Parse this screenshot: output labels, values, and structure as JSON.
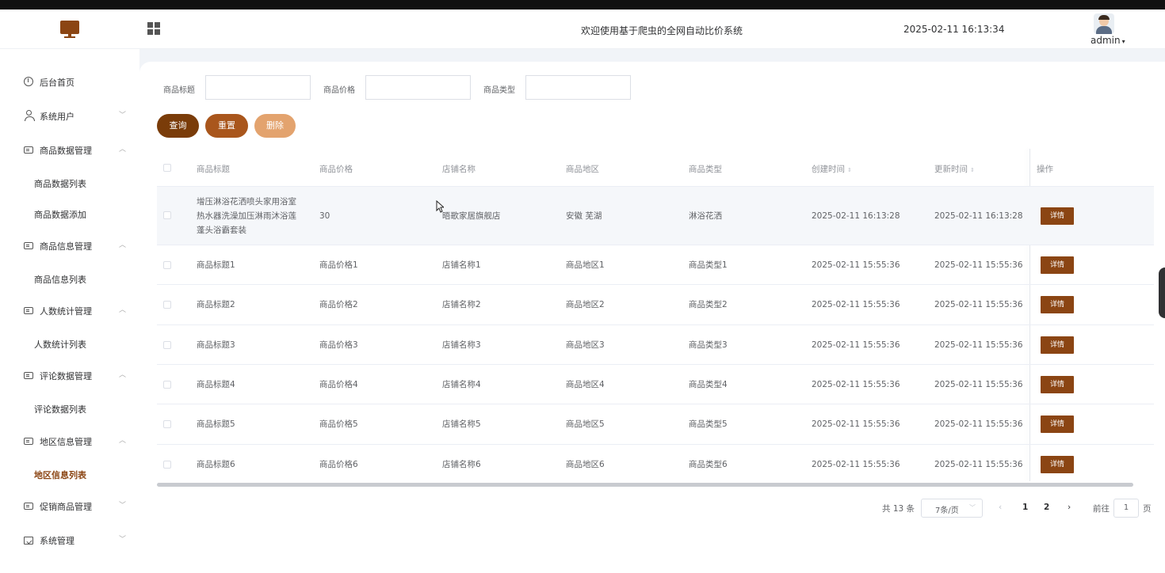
{
  "header": {
    "title": "欢迎使用基于爬虫的全网自动比价系统",
    "datetime": "2025-02-11 16:13:34",
    "user": "admin"
  },
  "sidebar": {
    "items": [
      {
        "label": "后台首页",
        "icon": "clock-icon",
        "arrow": ""
      },
      {
        "label": "系统用户",
        "icon": "user-icon",
        "arrow": "﹀"
      },
      {
        "label": "商品数据管理",
        "icon": "card-icon",
        "arrow": "︿"
      },
      {
        "label": "商品数据列表"
      },
      {
        "label": "商品数据添加"
      },
      {
        "label": "商品信息管理",
        "icon": "card-icon",
        "arrow": "︿"
      },
      {
        "label": "商品信息列表"
      },
      {
        "label": "人数统计管理",
        "icon": "card-icon",
        "arrow": "︿"
      },
      {
        "label": "人数统计列表"
      },
      {
        "label": "评论数据管理",
        "icon": "card-icon",
        "arrow": "︿"
      },
      {
        "label": "评论数据列表"
      },
      {
        "label": "地区信息管理",
        "icon": "card-icon",
        "arrow": "︿"
      },
      {
        "label": "地区信息列表"
      },
      {
        "label": "促销商品管理",
        "icon": "card-icon",
        "arrow": "﹀"
      },
      {
        "label": "系统管理",
        "icon": "folder-icon",
        "arrow": "﹀"
      }
    ]
  },
  "filters": {
    "title_label": "商品标题",
    "price_label": "商品价格",
    "type_label": "商品类型"
  },
  "buttons": {
    "query": "查询",
    "reset": "重置",
    "delete": "删除"
  },
  "table": {
    "headers": [
      "商品标题",
      "商品价格",
      "店铺名称",
      "商品地区",
      "商品类型",
      "创建时间",
      "更新时间",
      "操作"
    ],
    "detail_label": "详情",
    "rows": [
      {
        "title": "增压淋浴花洒喷头家用浴室热水器洗澡加压淋雨沐浴莲蓬头浴霸套装",
        "price": "30",
        "shop": "晤歌家居旗舰店",
        "region": "安徽 芜湖",
        "type": "淋浴花洒",
        "created": "2025-02-11 16:13:28",
        "updated": "2025-02-11 16:13:28"
      },
      {
        "title": "商品标题1",
        "price": "商品价格1",
        "shop": "店铺名称1",
        "region": "商品地区1",
        "type": "商品类型1",
        "created": "2025-02-11 15:55:36",
        "updated": "2025-02-11 15:55:36"
      },
      {
        "title": "商品标题2",
        "price": "商品价格2",
        "shop": "店铺名称2",
        "region": "商品地区2",
        "type": "商品类型2",
        "created": "2025-02-11 15:55:36",
        "updated": "2025-02-11 15:55:36"
      },
      {
        "title": "商品标题3",
        "price": "商品价格3",
        "shop": "店铺名称3",
        "region": "商品地区3",
        "type": "商品类型3",
        "created": "2025-02-11 15:55:36",
        "updated": "2025-02-11 15:55:36"
      },
      {
        "title": "商品标题4",
        "price": "商品价格4",
        "shop": "店铺名称4",
        "region": "商品地区4",
        "type": "商品类型4",
        "created": "2025-02-11 15:55:36",
        "updated": "2025-02-11 15:55:36"
      },
      {
        "title": "商品标题5",
        "price": "商品价格5",
        "shop": "店铺名称5",
        "region": "商品地区5",
        "type": "商品类型5",
        "created": "2025-02-11 15:55:36",
        "updated": "2025-02-11 15:55:36"
      },
      {
        "title": "商品标题6",
        "price": "商品价格6",
        "shop": "店铺名称6",
        "region": "商品地区6",
        "type": "商品类型6",
        "created": "2025-02-11 15:55:36",
        "updated": "2025-02-11 15:55:36"
      }
    ]
  },
  "pagination": {
    "total": "共 13 条",
    "page_size": "7条/页",
    "pages": [
      "1",
      "2"
    ],
    "goto_label": "前往",
    "goto_value": "1",
    "page_suffix": "页"
  },
  "colors": {
    "accent": "#8b4513",
    "query_button": "#7a3c09",
    "reset_button": "#a9561c",
    "delete_button": "#e3a36e"
  }
}
